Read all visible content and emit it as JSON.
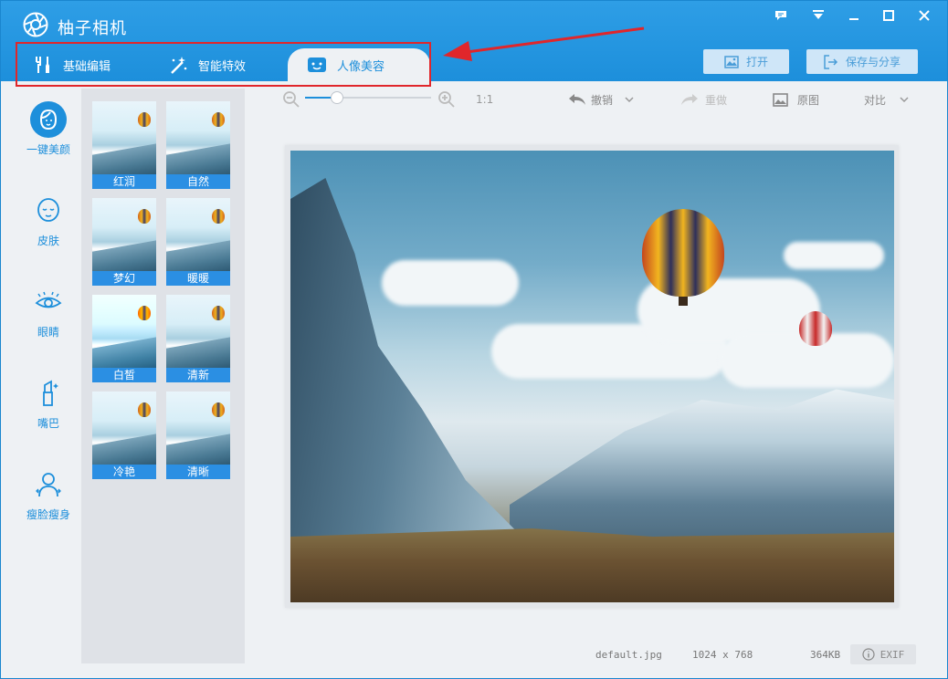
{
  "app": {
    "title": "柚子相机"
  },
  "tabs": [
    {
      "label": "基础编辑",
      "icon": "tools-icon"
    },
    {
      "label": "智能特效",
      "icon": "magic-wand-icon"
    },
    {
      "label": "人像美容",
      "icon": "face-portrait-icon",
      "active": true
    }
  ],
  "header_buttons": {
    "open": "打开",
    "save_share": "保存与分享"
  },
  "toolbar": {
    "zoom_ratio": "1:1",
    "zoom_level": 0.25,
    "undo": "撤销",
    "redo": "重做",
    "original": "原图",
    "compare": "对比"
  },
  "left_nav": [
    {
      "label": "一键美颜",
      "icon": "beauty-face-icon",
      "active": true
    },
    {
      "label": "皮肤",
      "icon": "skin-face-icon"
    },
    {
      "label": "眼睛",
      "icon": "eye-icon"
    },
    {
      "label": "嘴巴",
      "icon": "lipstick-icon"
    },
    {
      "label": "瘦脸瘦身",
      "icon": "slim-body-icon"
    }
  ],
  "presets": [
    {
      "label": "红润"
    },
    {
      "label": "自然"
    },
    {
      "label": "梦幻"
    },
    {
      "label": "暖暖"
    },
    {
      "label": "白皙"
    },
    {
      "label": "清新"
    },
    {
      "label": "冷艳"
    },
    {
      "label": "清晰"
    }
  ],
  "status": {
    "filename": "default.jpg",
    "dimensions": "1024 x 768",
    "filesize": "364KB",
    "exif": "EXIF"
  },
  "colors": {
    "accent": "#1d8fdb",
    "preset_label": "#2b8fe3",
    "highlight": "#e0262b"
  }
}
